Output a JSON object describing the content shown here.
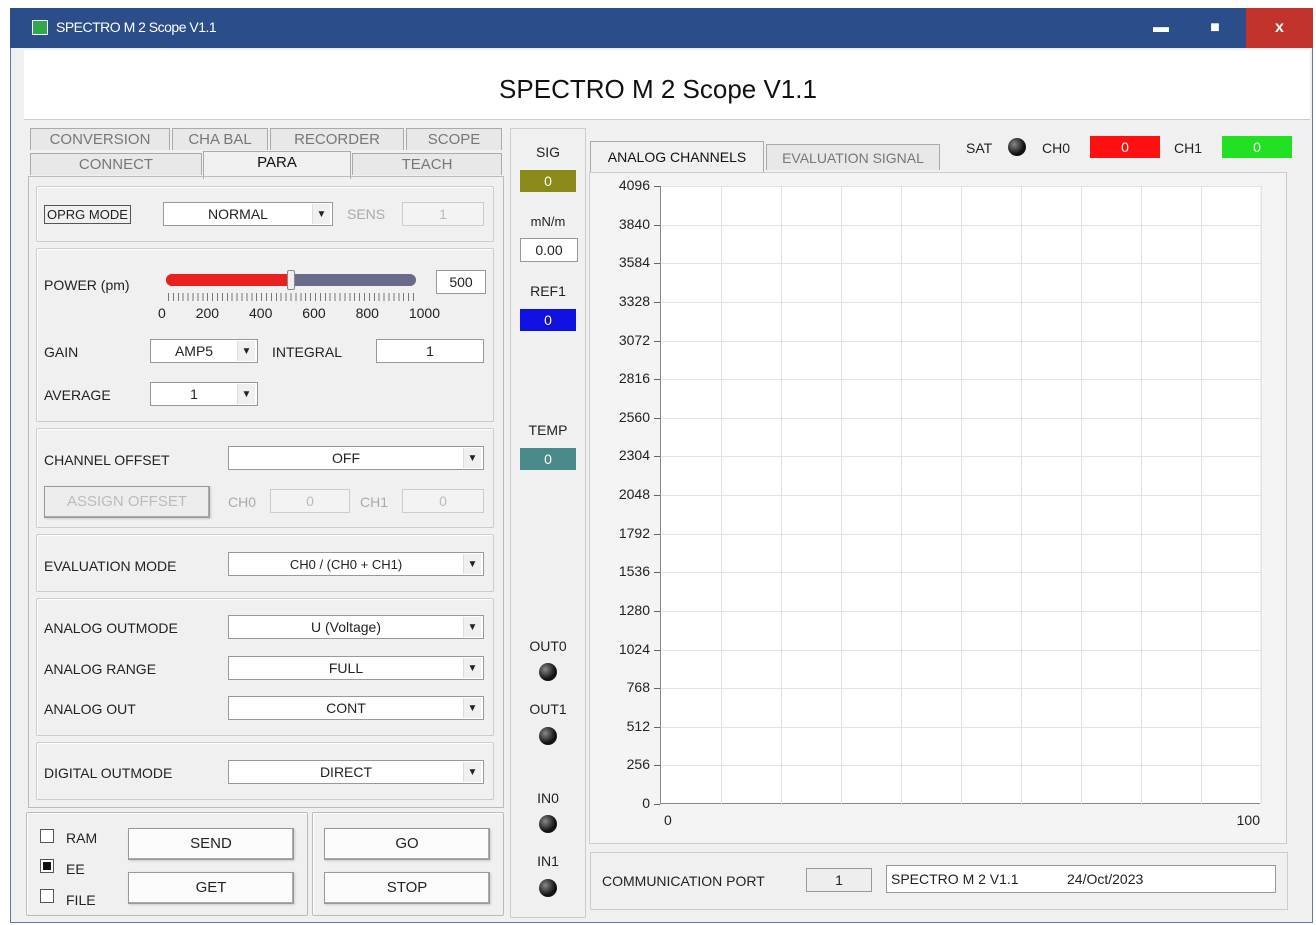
{
  "window": {
    "title": "SPECTRO M 2 Scope V1.1",
    "app_title": "SPECTRO M 2 Scope V1.1",
    "min_glyph": "▬",
    "max_glyph": "■",
    "close_glyph": "x"
  },
  "left_tabs": {
    "row1": [
      "CONVERSION",
      "CHA BAL",
      "RECORDER",
      "SCOPE"
    ],
    "row2": [
      "CONNECT",
      "PARA",
      "TEACH"
    ],
    "active": "PARA"
  },
  "oprg": {
    "label": "OPRG MODE",
    "value": "NORMAL",
    "sens_label": "SENS",
    "sens_value": "1"
  },
  "power": {
    "label": "POWER (pm)",
    "value": "500",
    "level": 0.5,
    "scale": [
      "0",
      "200",
      "400",
      "600",
      "800",
      "1000"
    ]
  },
  "gain": {
    "label": "GAIN",
    "value": "AMP5"
  },
  "integral": {
    "label": "INTEGRAL",
    "value": "1"
  },
  "average": {
    "label": "AVERAGE",
    "value": "1"
  },
  "channel_offset": {
    "label": "CHANNEL OFFSET",
    "value": "OFF",
    "assign_label": "ASSIGN OFFSET",
    "ch0_label": "CH0",
    "ch0_value": "0",
    "ch1_label": "CH1",
    "ch1_value": "0"
  },
  "evaluation_mode": {
    "label": "EVALUATION MODE",
    "value": "CH0 / (CH0 + CH1)"
  },
  "analog": {
    "outmode_label": "ANALOG OUTMODE",
    "outmode_value": "U (Voltage)",
    "range_label": "ANALOG RANGE",
    "range_value": "FULL",
    "out_label": "ANALOG OUT",
    "out_value": "CONT"
  },
  "digital": {
    "label": "DIGITAL OUTMODE",
    "value": "DIRECT"
  },
  "storage": {
    "ram_label": "RAM",
    "ram_checked": false,
    "ee_label": "EE",
    "ee_checked": true,
    "file_label": "FILE",
    "file_checked": false
  },
  "buttons": {
    "send": "SEND",
    "get": "GET",
    "go": "GO",
    "stop": "STOP"
  },
  "side": {
    "sig_label": "SIG",
    "sig_value": "0",
    "sig_color": "#8a8a1a",
    "unit_label": "mN/m",
    "unit_value": "0.00",
    "ref1_label": "REF1",
    "ref1_value": "0",
    "ref1_color": "#1010e0",
    "temp_label": "TEMP",
    "temp_value": "0",
    "temp_color": "#4a8a8a",
    "out0_label": "OUT0",
    "out1_label": "OUT1",
    "in0_label": "IN0",
    "in1_label": "IN1"
  },
  "chart_tabs": {
    "analog": "ANALOG CHANNELS",
    "evaluation": "EVALUATION SIGNAL",
    "active": "ANALOG CHANNELS"
  },
  "status": {
    "sat_label": "SAT",
    "ch0_label": "CH0",
    "ch0_value": "0",
    "ch0_color": "#ff1010",
    "ch1_label": "CH1",
    "ch1_value": "0",
    "ch1_color": "#22e022"
  },
  "chart_data": {
    "type": "line",
    "x_ticks": [
      "0",
      "100"
    ],
    "xlim": [
      0,
      100
    ],
    "y_ticks": [
      "4096",
      "3840",
      "3584",
      "3328",
      "3072",
      "2816",
      "2560",
      "2304",
      "2048",
      "1792",
      "1536",
      "1280",
      "1024",
      "768",
      "512",
      "256",
      "0"
    ],
    "ylim": [
      0,
      4096
    ],
    "grid": true,
    "series": []
  },
  "comm": {
    "label": "COMMUNICATION PORT",
    "port": "1",
    "device": "SPECTRO M 2 V1.1",
    "date": "24/Oct/2023"
  }
}
